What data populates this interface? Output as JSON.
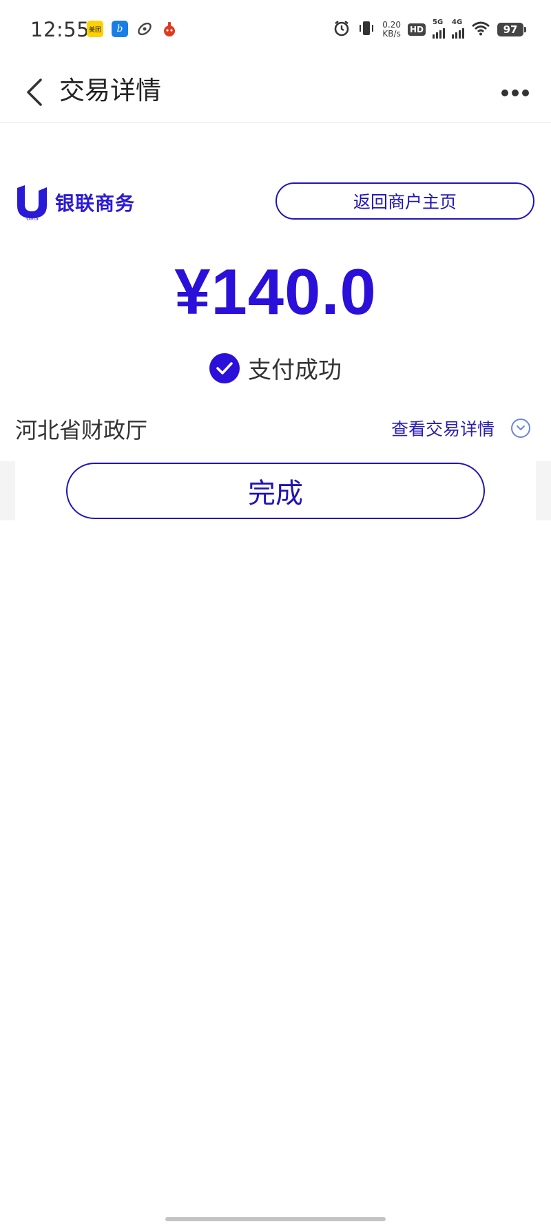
{
  "status_bar": {
    "time": "12:55",
    "app_icons": [
      {
        "name": "meituan-app-icon",
        "text": "美团"
      },
      {
        "name": "browser-app-icon",
        "text": "b"
      },
      {
        "name": "swirl-app-icon",
        "text": ""
      },
      {
        "name": "red-app-icon",
        "text": ""
      }
    ],
    "net_speed_value": "0.20",
    "net_speed_unit": "KB/s",
    "hd_label": "HD",
    "sim1_label": "5G",
    "sim2_label": "4G",
    "battery_level": "97"
  },
  "header": {
    "title": "交易详情",
    "back_icon": "chevron-left-icon",
    "more_icon": "more-dots-icon"
  },
  "merchant": {
    "brand_name": "银联商务",
    "brand_sub": "UMS",
    "return_button_label": "返回商户主页"
  },
  "transaction": {
    "amount": "¥140.0",
    "status_text": "支付成功",
    "payee": "河北省财政厅",
    "view_details_label": "查看交易详情"
  },
  "actions": {
    "done_label": "完成"
  },
  "colors": {
    "accent": "#2a10d8",
    "button_border": "#1f14b8",
    "chevron_circle": "#6b86d4"
  }
}
